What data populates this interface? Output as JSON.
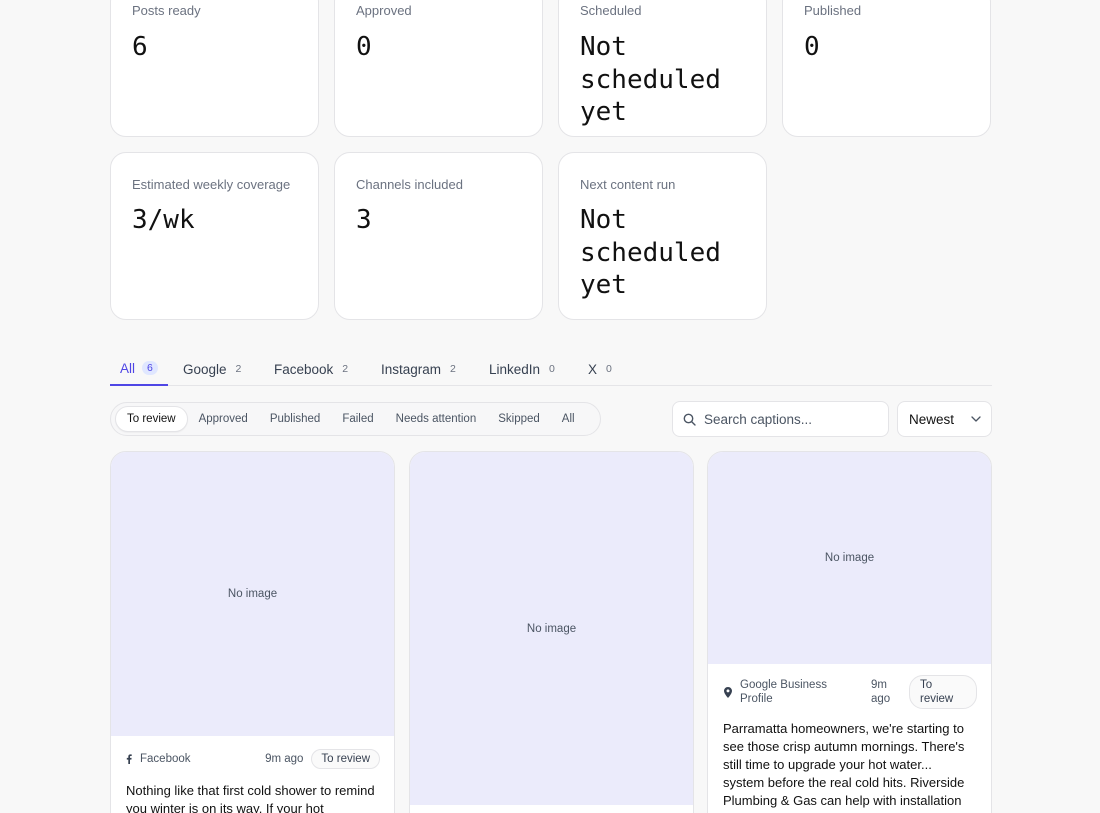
{
  "stats": {
    "row1": [
      {
        "label": "Posts ready",
        "value": "6"
      },
      {
        "label": "Approved",
        "value": "0"
      },
      {
        "label": "Scheduled",
        "value": "Not scheduled yet"
      },
      {
        "label": "Published",
        "value": "0"
      }
    ],
    "row2": [
      {
        "label": "Estimated weekly coverage",
        "value": "3/wk"
      },
      {
        "label": "Channels included",
        "value": "3"
      },
      {
        "label": "Next content run",
        "value": "Not scheduled yet"
      }
    ]
  },
  "channel_tabs": [
    {
      "label": "All",
      "count": "6"
    },
    {
      "label": "Google",
      "count": "2"
    },
    {
      "label": "Facebook",
      "count": "2"
    },
    {
      "label": "Instagram",
      "count": "2"
    },
    {
      "label": "LinkedIn",
      "count": "0"
    },
    {
      "label": "X",
      "count": "0"
    }
  ],
  "status_filters": [
    "To review",
    "Approved",
    "Published",
    "Failed",
    "Needs attention",
    "Skipped",
    "All"
  ],
  "search": {
    "placeholder": "Search captions..."
  },
  "sort": {
    "value": "Newest"
  },
  "posts": [
    {
      "image_text": "No image",
      "channel": "Facebook",
      "time": "9m ago",
      "status": "To review",
      "caption": "Nothing like that first cold shower to remind you winter is on its way. If your hot"
    },
    {
      "image_text": "No image"
    },
    {
      "image_text": "No image",
      "channel": "Google Business Profile",
      "time": "9m ago",
      "status": "To review",
      "caption": "Parramatta homeowners, we're starting to see those crisp autumn mornings. There's still time to upgrade your hot water... system before the real cold hits. Riverside Plumbing & Gas can help with installation"
    }
  ],
  "colors": {
    "accent": "#4f46e5",
    "image_placeholder": "#ebebfb"
  }
}
